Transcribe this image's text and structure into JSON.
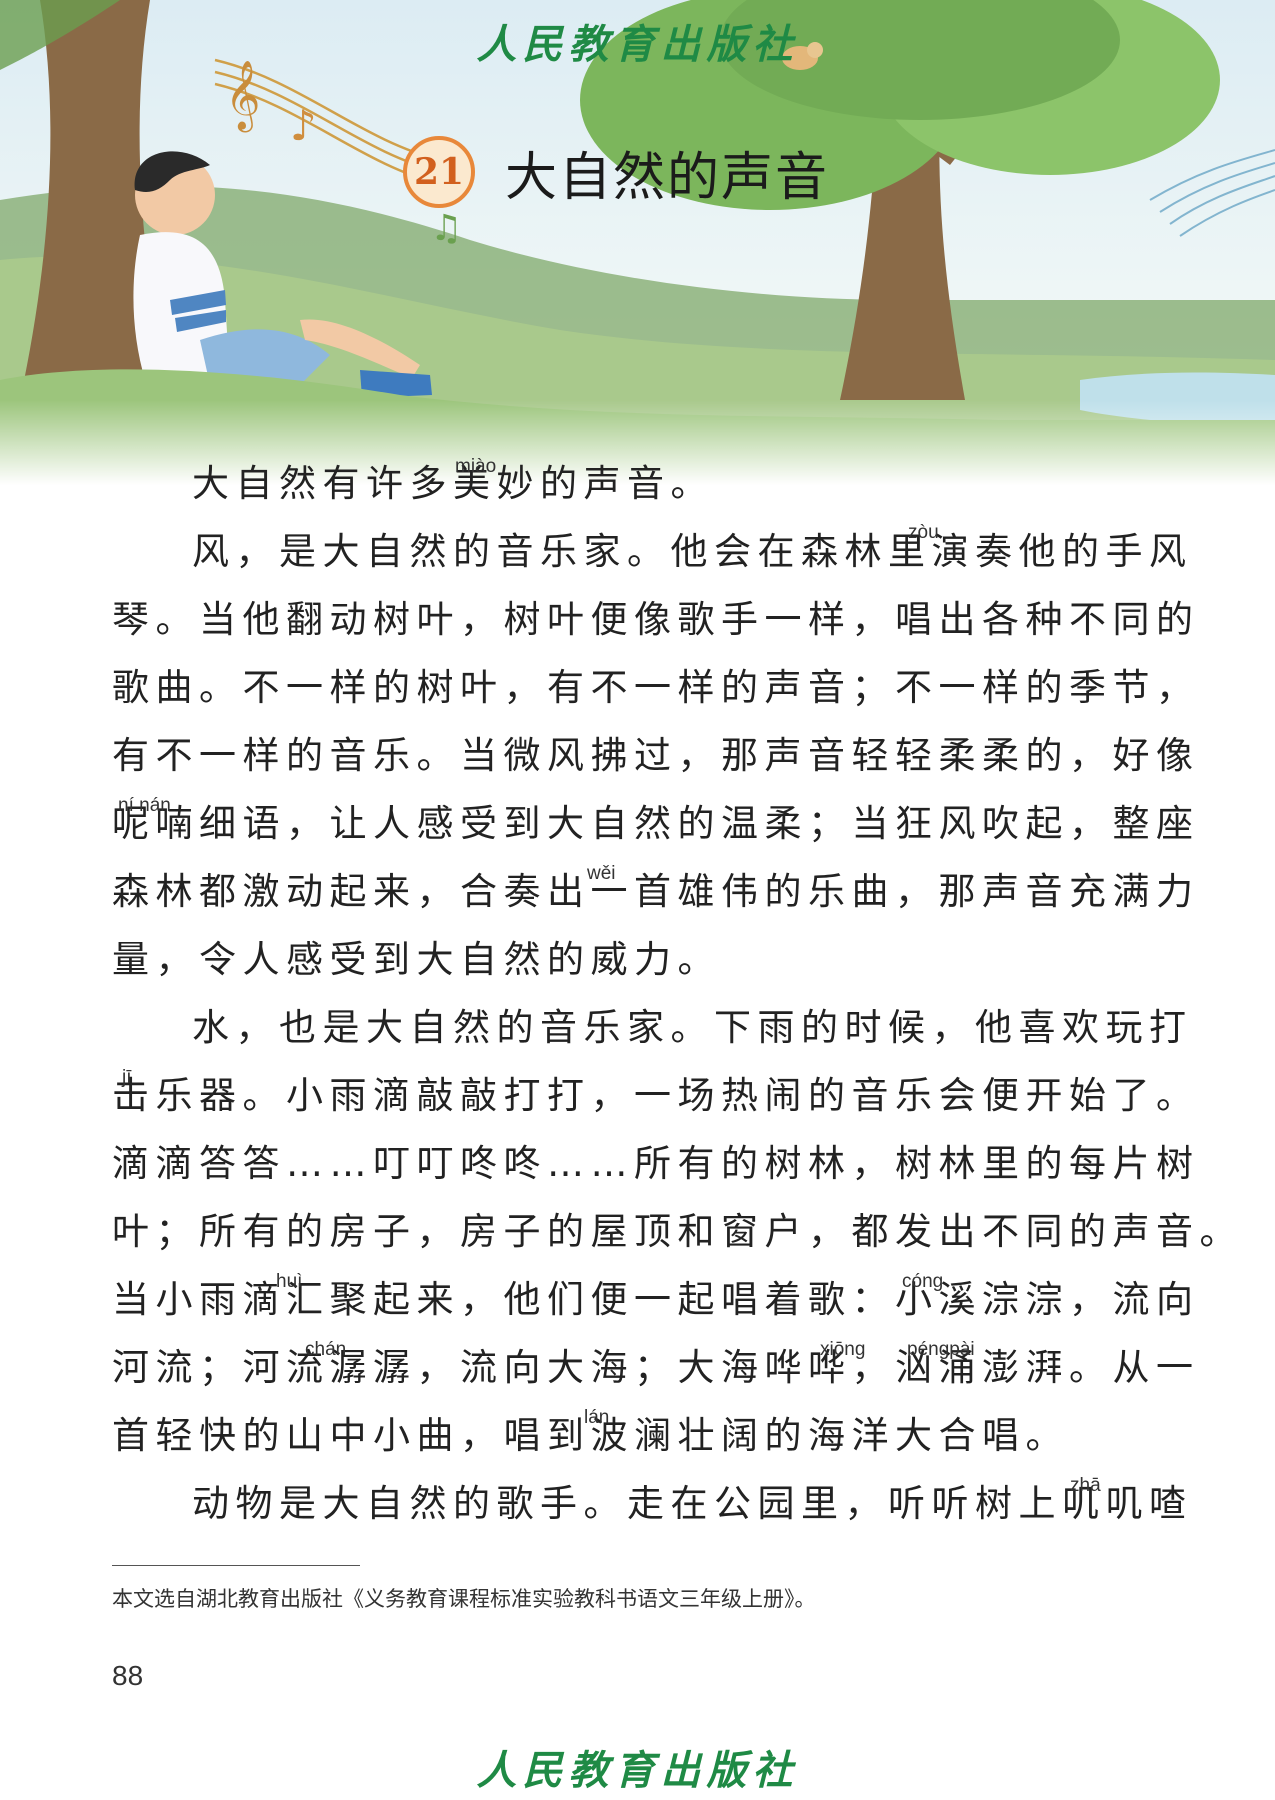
{
  "publisher": "人民教育出版社",
  "lesson": {
    "number": "21",
    "title": "大自然的声音"
  },
  "lines": [
    "大自然有许多美妙的声音。",
    "风，是大自然的音乐家。他会在森林里演奏他的手风",
    "琴。当他翻动树叶，树叶便像歌手一样，唱出各种不同的",
    "歌曲。不一样的树叶，有不一样的声音；不一样的季节，",
    "有不一样的音乐。当微风拂过，那声音轻轻柔柔的，好像",
    "呢喃细语，让人感受到大自然的温柔；当狂风吹起，整座",
    "森林都激动起来，合奏出一首雄伟的乐曲，那声音充满力",
    "量，令人感受到大自然的威力。",
    "水，也是大自然的音乐家。下雨的时候，他喜欢玩打",
    "击乐器。小雨滴敲敲打打，一场热闹的音乐会便开始了。",
    "滴滴答答……叮叮咚咚……所有的树林，树林里的每片树",
    "叶；所有的房子，房子的屋顶和窗户，都发出不同的声音。",
    "当小雨滴汇聚起来，他们便一起唱着歌：小溪淙淙，流向",
    "河流；河流潺潺，流向大海；大海哗哗，汹涌澎湃。从一",
    "首轻快的山中小曲，唱到波澜壮阔的海洋大合唱。",
    "动物是大自然的歌手。走在公园里，听听树上叽叽喳"
  ],
  "pinyin": [
    "miào",
    "zòu",
    "ní nán",
    "wěi",
    "jī",
    "huì",
    "cóng",
    "chán",
    "xiōng",
    "péngpài",
    "lán",
    "zhā"
  ],
  "footnote": "本文选自湖北教育出版社《义务教育课程标准实验教科书语文三年级上册》。",
  "page_number": "88"
}
